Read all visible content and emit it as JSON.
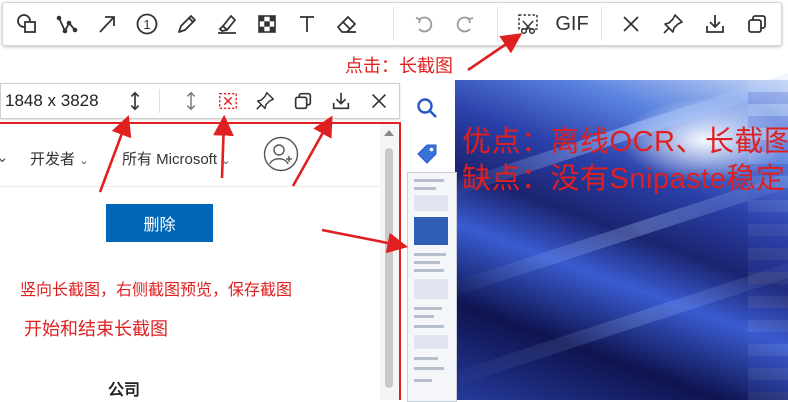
{
  "top_toolbar": {
    "tools": [
      {
        "name": "shape-tool",
        "icon": "shape-icon"
      },
      {
        "name": "polyline-tool",
        "icon": "polyline-icon"
      },
      {
        "name": "arrow-tool",
        "icon": "arrow-icon"
      },
      {
        "name": "number-tool",
        "icon": "number-circle-icon",
        "label": "1"
      },
      {
        "name": "pen-tool",
        "icon": "pencil-icon"
      },
      {
        "name": "marker-tool",
        "icon": "highlighter-icon"
      },
      {
        "name": "mosaic-tool",
        "icon": "mosaic-icon"
      },
      {
        "name": "text-tool",
        "icon": "text-icon",
        "label": "T"
      },
      {
        "name": "eraser-tool",
        "icon": "eraser-icon"
      },
      {
        "name": "undo",
        "icon": "undo-icon"
      },
      {
        "name": "redo",
        "icon": "redo-icon"
      },
      {
        "name": "long-screenshot",
        "icon": "long-screenshot-icon"
      },
      {
        "name": "gif",
        "icon": "gif-icon"
      },
      {
        "name": "close",
        "icon": "close-icon"
      },
      {
        "name": "pin",
        "icon": "pin-icon"
      },
      {
        "name": "save",
        "icon": "download-icon"
      },
      {
        "name": "copy",
        "icon": "copy-icon"
      }
    ],
    "gif_label": "GIF",
    "accent": "#e02020"
  },
  "annotations": {
    "longshot_label": "点击：长截图",
    "pros": "优点：离线OCR、长截图",
    "cons": "缺点：没有Snipaste稳定",
    "vertical_note": "竖向长截图，右侧截图预览，保存截图",
    "start_end_note": "开始和结束长截图",
    "color": "#e02020"
  },
  "long_toolbar": {
    "size_readout": "1848 x 3828",
    "buttons": [
      "resize-vertical-icon",
      "resize-vertical-icon",
      "stop-longshot-icon",
      "pin-icon",
      "copy-icon",
      "download-icon",
      "close-icon"
    ]
  },
  "webpage": {
    "nav_items": [
      "开发者",
      "所有 Microsoft"
    ],
    "delete_label": "删除",
    "company_label": "公司",
    "button_color": "#0067b8"
  },
  "side_panel": {
    "icons": [
      "search-icon",
      "tag-icon"
    ]
  }
}
